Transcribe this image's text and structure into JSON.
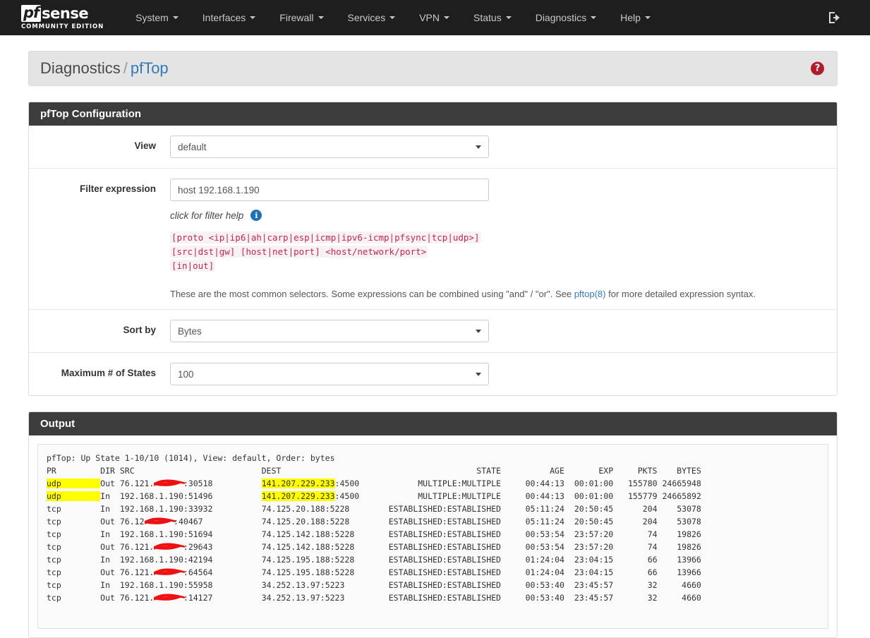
{
  "navbar": {
    "logo_mark": "pf",
    "logo_word": "sense",
    "logo_subtitle": "COMMUNITY EDITION",
    "menu": [
      {
        "label": "System"
      },
      {
        "label": "Interfaces"
      },
      {
        "label": "Firewall"
      },
      {
        "label": "Services"
      },
      {
        "label": "VPN"
      },
      {
        "label": "Status"
      },
      {
        "label": "Diagnostics"
      },
      {
        "label": "Help"
      }
    ],
    "logout_icon": "logout-icon"
  },
  "breadcrumb": {
    "parent": "Diagnostics",
    "separator": "/",
    "current": "pfTop",
    "help_icon_glyph": "?"
  },
  "config_panel": {
    "title": "pfTop Configuration",
    "view": {
      "label": "View",
      "value": "default"
    },
    "filter": {
      "label": "Filter expression",
      "value": "host 192.168.1.190",
      "help_text": "click for filter help",
      "info_icon_glyph": "i",
      "syntax_lines": [
        "[proto <ip|ip6|ah|carp|esp|icmp|ipv6-icmp|pfsync|tcp|udp>]",
        "[src|dst|gw] [host|net|port] <host/network/port>",
        "[in|out]"
      ],
      "note_prefix": "These are the most common selectors. Some expressions can be combined using \"and\" / \"or\". See ",
      "note_link": "pftop(8)",
      "note_suffix": " for more detailed expression syntax."
    },
    "sort_by": {
      "label": "Sort by",
      "value": "Bytes"
    },
    "max_states": {
      "label": "Maximum # of States",
      "value": "100"
    }
  },
  "output_panel": {
    "title": "Output",
    "status_line": "pfTop: Up State 1-10/10 (1014), View: default, Order: bytes",
    "columns": {
      "pr": "PR",
      "dir": "DIR",
      "src": "SRC",
      "dest": "DEST",
      "state": "STATE",
      "age": "AGE",
      "exp": "EXP",
      "pkts": "PKTS",
      "bytes": "BYTES"
    },
    "rows": [
      {
        "pr": "udp",
        "pr_highlight": true,
        "dir": "Out",
        "src_prefix": "76.121.",
        "src_redacted": true,
        "src_port": ":30518",
        "dest_ip": "141.207.229.233",
        "dest_highlight": true,
        "dest_port": ":4500",
        "state": "MULTIPLE:MULTIPLE",
        "age": "00:44:13",
        "exp": "00:01:00",
        "pkts": "155780",
        "bytes": "24665948"
      },
      {
        "pr": "udp",
        "pr_highlight": true,
        "dir": "In",
        "src_prefix": "192.168.1.190",
        "src_redacted": false,
        "src_port": ":51496",
        "dest_ip": "141.207.229.233",
        "dest_highlight": true,
        "dest_port": ":4500",
        "state": "MULTIPLE:MULTIPLE",
        "age": "00:44:13",
        "exp": "00:01:00",
        "pkts": "155779",
        "bytes": "24665892"
      },
      {
        "pr": "tcp",
        "pr_highlight": false,
        "dir": "In",
        "src_prefix": "192.168.1.190",
        "src_redacted": false,
        "src_port": ":33932",
        "dest_ip": "74.125.20.188",
        "dest_highlight": false,
        "dest_port": ":5228",
        "state": "ESTABLISHED:ESTABLISHED",
        "age": "05:11:24",
        "exp": "20:50:45",
        "pkts": "204",
        "bytes": "53078"
      },
      {
        "pr": "tcp",
        "pr_highlight": false,
        "dir": "Out",
        "src_prefix": "76.12",
        "src_redacted": true,
        "src_port": ":40467",
        "dest_ip": "74.125.20.188",
        "dest_highlight": false,
        "dest_port": ":5228",
        "state": "ESTABLISHED:ESTABLISHED",
        "age": "05:11:24",
        "exp": "20:50:45",
        "pkts": "204",
        "bytes": "53078"
      },
      {
        "pr": "tcp",
        "pr_highlight": false,
        "dir": "In",
        "src_prefix": "192.168.1.190",
        "src_redacted": false,
        "src_port": ":51694",
        "dest_ip": "74.125.142.188",
        "dest_highlight": false,
        "dest_port": ":5228",
        "state": "ESTABLISHED:ESTABLISHED",
        "age": "00:53:54",
        "exp": "23:57:20",
        "pkts": "74",
        "bytes": "19826"
      },
      {
        "pr": "tcp",
        "pr_highlight": false,
        "dir": "Out",
        "src_prefix": "76.121.",
        "src_redacted": true,
        "src_port": ":29643",
        "dest_ip": "74.125.142.188",
        "dest_highlight": false,
        "dest_port": ":5228",
        "state": "ESTABLISHED:ESTABLISHED",
        "age": "00:53:54",
        "exp": "23:57:20",
        "pkts": "74",
        "bytes": "19826"
      },
      {
        "pr": "tcp",
        "pr_highlight": false,
        "dir": "In",
        "src_prefix": "192.168.1.190",
        "src_redacted": false,
        "src_port": ":42194",
        "dest_ip": "74.125.195.188",
        "dest_highlight": false,
        "dest_port": ":5228",
        "state": "ESTABLISHED:ESTABLISHED",
        "age": "01:24:04",
        "exp": "23:04:15",
        "pkts": "66",
        "bytes": "13966"
      },
      {
        "pr": "tcp",
        "pr_highlight": false,
        "dir": "Out",
        "src_prefix": "76.121.",
        "src_redacted": true,
        "src_port": ":64564",
        "dest_ip": "74.125.195.188",
        "dest_highlight": false,
        "dest_port": ":5228",
        "state": "ESTABLISHED:ESTABLISHED",
        "age": "01:24:04",
        "exp": "23:04:15",
        "pkts": "66",
        "bytes": "13966"
      },
      {
        "pr": "tcp",
        "pr_highlight": false,
        "dir": "In",
        "src_prefix": "192.168.1.190",
        "src_redacted": false,
        "src_port": ":55958",
        "dest_ip": "34.252.13.97",
        "dest_highlight": false,
        "dest_port": ":5223",
        "state": "ESTABLISHED:ESTABLISHED",
        "age": "00:53:40",
        "exp": "23:45:57",
        "pkts": "32",
        "bytes": "4660"
      },
      {
        "pr": "tcp",
        "pr_highlight": false,
        "dir": "Out",
        "src_prefix": "76.121.",
        "src_redacted": true,
        "src_port": ":14127",
        "dest_ip": "34.252.13.97",
        "dest_highlight": false,
        "dest_port": ":5223",
        "state": "ESTABLISHED:ESTABLISHED",
        "age": "00:53:40",
        "exp": "23:45:57",
        "pkts": "32",
        "bytes": "4660"
      }
    ]
  },
  "colors": {
    "navbar_bg": "#1e1e1e",
    "panel_head_bg": "#3c3c3c",
    "link": "#337ab7",
    "syntax_text": "#c7254e",
    "highlight": "#ffff00",
    "redaction": "#ee1111",
    "help_badge": "#b01c2e"
  }
}
